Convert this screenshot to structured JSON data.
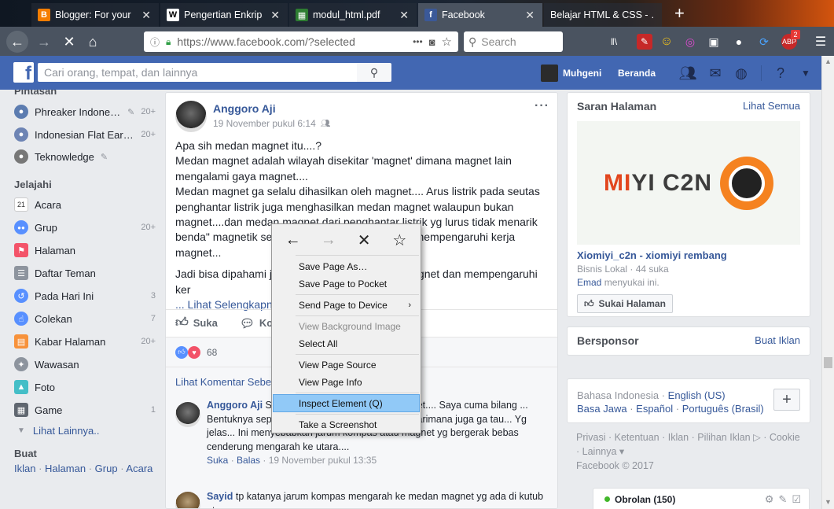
{
  "browser": {
    "tabs": [
      {
        "title": "Blogger: For your I…",
        "favicon": "B",
        "color": "#f57d00",
        "active": false
      },
      {
        "title": "Pengertian Enkripsi…",
        "favicon": "W",
        "color": "#ffffff",
        "active": false
      },
      {
        "title": "modul_html.pdf",
        "favicon": "▦",
        "color": "#2e7d32",
        "active": false
      },
      {
        "title": "Facebook",
        "favicon": "f",
        "color": "#3b5998",
        "active": true
      },
      {
        "title": "Belajar HTML & CSS - …",
        "favicon": "",
        "color": "#888888",
        "active": false
      }
    ],
    "new_tab": "+",
    "url": "https://www.facebook.com/?selected",
    "search_placeholder": "Search",
    "notification_badge": "2"
  },
  "facebook": {
    "search_placeholder": "Cari orang, tempat, dan lainnya",
    "user_name": "Muhgeni",
    "home_label": "Beranda"
  },
  "sidebar": {
    "pinned_header": "Pintasan",
    "shortcuts": [
      {
        "label": "Phreaker Indone…",
        "count": "20+",
        "color": "#5c7cb0"
      },
      {
        "label": "Indonesian Flat Ear…",
        "count": "20+",
        "color": "#6d84b4"
      },
      {
        "label": "Teknowledge",
        "count": "",
        "color": "#777777"
      }
    ],
    "explore_header": "Jelajahi",
    "explore": [
      {
        "label": "Acara",
        "count": "",
        "icon": "21",
        "color": "#e9ebee"
      },
      {
        "label": "Grup",
        "count": "20+",
        "icon": "●●",
        "color": "#5890ff"
      },
      {
        "label": "Halaman",
        "count": "",
        "icon": "⚑",
        "color": "#f35369"
      },
      {
        "label": "Daftar Teman",
        "count": "",
        "icon": "☰",
        "color": "#8d949e"
      },
      {
        "label": "Pada Hari Ini",
        "count": "3",
        "icon": "↺",
        "color": "#5890ff"
      },
      {
        "label": "Colekan",
        "count": "7",
        "icon": "☝",
        "color": "#5890ff"
      },
      {
        "label": "Kabar Halaman",
        "count": "20+",
        "icon": "▤",
        "color": "#f7923b"
      },
      {
        "label": "Wawasan",
        "count": "",
        "icon": "✦",
        "color": "#8d949e"
      },
      {
        "label": "Foto",
        "count": "",
        "icon": "▲",
        "color": "#44bec7"
      },
      {
        "label": "Game",
        "count": "1",
        "icon": "▦",
        "color": "#606770"
      }
    ],
    "see_more": "Lihat Lainnya..",
    "create_header": "Buat",
    "create_links": [
      "Iklan",
      "Halaman",
      "Grup",
      "Acara"
    ]
  },
  "post": {
    "author": "Anggoro Aji",
    "time": "19 November pukul 6:14",
    "paragraphs": [
      "Apa sih medan magnet itu....?",
      "Medan magnet adalah wilayah disekitar 'magnet' dimana magnet lain mengalami gaya magnet....",
      "Medan magnet ga selalu dihasilkan oleh magnet.... Arus listrik pada seutas penghantar listrik juga menghasilkan medan magnet walaupun bukan magnet....dan medan magnet dari penghantar listrik yg lurus tidak menarik benda\" magnetik seperti magnet biasa.... namun mempengaruhi kerja magnet...",
      "Jadi bisa dipahami jika ... arus listrik ... medan magnet dan mempengaruhi ker"
    ],
    "see_more": "... Lihat Selengkapnya",
    "like_label": "Suka",
    "comment_label": "Komentari",
    "reaction_count": "68",
    "previous_comments": "Lihat Komentar Sebelumnya",
    "comments": [
      {
        "author": "Anggoro Aji",
        "text": "Saya cuma bilang ... sumber magnet.... Saya cuma bilang ... Bentuknya seperti apa...kita ga tau... Gunanya darimana juga ga tau... Yg jelas... Ini menyebabkan jarum kompas atau magnet yg bergerak bebas cenderung mengarah ke utara....",
        "like": "Suka",
        "reply": "Balas",
        "time": "19 November pukul 13:35"
      },
      {
        "author": "Sayid",
        "text": "tp katanya jarum kompas mengarah ke medan magnet yg ada di kutub utara",
        "like": "",
        "reply": "",
        "time": ""
      }
    ]
  },
  "right": {
    "suggest_title": "Saran Halaman",
    "see_all": "Lihat Semua",
    "ad_logo_left": "MI",
    "ad_logo_right": "YI C2N",
    "page_name": "Xiomiyi_c2n - xiomiyi rembang",
    "page_sub": "Bisnis Lokal · 44 suka",
    "page_friend": "Emad",
    "page_friend_suffix": " menyukai ini.",
    "like_page": "Sukai Halaman",
    "sponsor_title": "Bersponsor",
    "create_ad": "Buat Iklan",
    "languages": [
      "Bahasa Indonesia",
      "English (US)",
      "Basa Jawa",
      "Español",
      "Português (Brasil)"
    ],
    "lang_plus": "+",
    "footer": "Privasi · Ketentuan · Iklan · Pilihan Iklan ▷ · Cookie · Lainnya ▾",
    "copyright": "Facebook © 2017",
    "chat_label": "Obrolan (150)"
  },
  "context_menu": {
    "items": [
      {
        "label": "Save Page As…",
        "enabled": true
      },
      {
        "label": "Save Page to Pocket",
        "enabled": true
      },
      {
        "label": "Send Page to Device",
        "enabled": true,
        "submenu": true
      },
      {
        "label": "View Background Image",
        "enabled": false
      },
      {
        "label": "Select All",
        "enabled": true
      },
      {
        "label": "View Page Source",
        "enabled": true
      },
      {
        "label": "View Page Info",
        "enabled": true
      },
      {
        "label": "Inspect Element (Q)",
        "enabled": true,
        "highlighted": true
      },
      {
        "label": "Take a Screenshot",
        "enabled": true
      }
    ]
  }
}
